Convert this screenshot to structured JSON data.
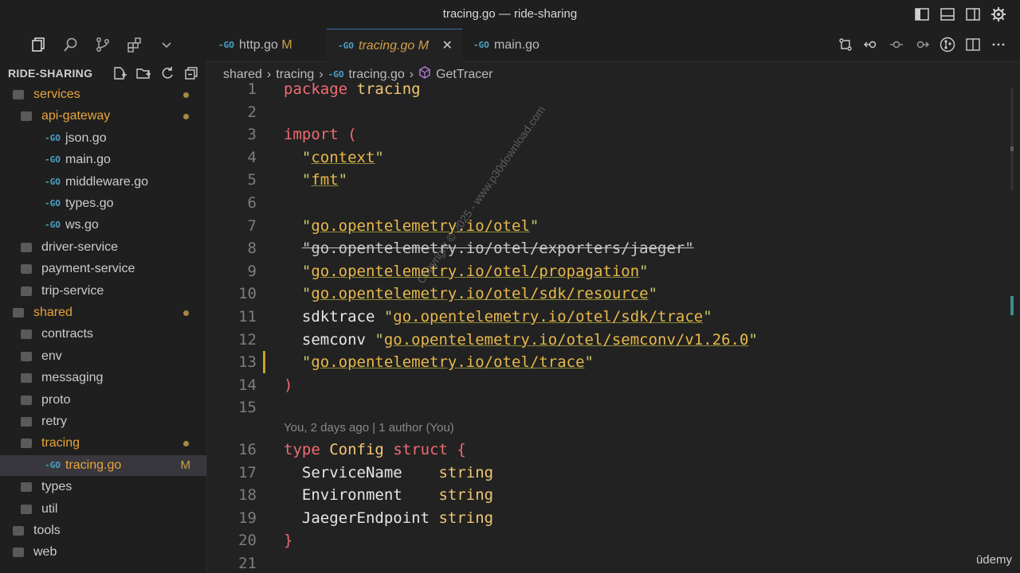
{
  "window": {
    "title": "tracing.go — ride-sharing"
  },
  "sidebar": {
    "header": "RIDE-SHARING",
    "items": [
      {
        "label": "services",
        "kind": "folder",
        "depth": 0,
        "dot": true,
        "color": "#e8a53c"
      },
      {
        "label": "api-gateway",
        "kind": "folder",
        "depth": 1,
        "dot": true,
        "color": "#e8a53c"
      },
      {
        "label": "json.go",
        "kind": "go",
        "depth": 2
      },
      {
        "label": "main.go",
        "kind": "go",
        "depth": 2
      },
      {
        "label": "middleware.go",
        "kind": "go",
        "depth": 2
      },
      {
        "label": "types.go",
        "kind": "go",
        "depth": 2
      },
      {
        "label": "ws.go",
        "kind": "go",
        "depth": 2
      },
      {
        "label": "driver-service",
        "kind": "folder",
        "depth": 1
      },
      {
        "label": "payment-service",
        "kind": "folder",
        "depth": 1
      },
      {
        "label": "trip-service",
        "kind": "folder",
        "depth": 1
      },
      {
        "label": "shared",
        "kind": "folder",
        "depth": 0,
        "dot": true,
        "color": "#e8a53c"
      },
      {
        "label": "contracts",
        "kind": "folder",
        "depth": 1
      },
      {
        "label": "env",
        "kind": "folder",
        "depth": 1
      },
      {
        "label": "messaging",
        "kind": "folder",
        "depth": 1
      },
      {
        "label": "proto",
        "kind": "folder",
        "depth": 1
      },
      {
        "label": "retry",
        "kind": "folder",
        "depth": 1
      },
      {
        "label": "tracing",
        "kind": "folder",
        "depth": 1,
        "dot": true,
        "color": "#e8a53c"
      },
      {
        "label": "tracing.go",
        "kind": "go",
        "depth": 2,
        "active": true,
        "mod": "M",
        "color": "#e8a53c"
      },
      {
        "label": "types",
        "kind": "folder",
        "depth": 1
      },
      {
        "label": "util",
        "kind": "folder",
        "depth": 1
      },
      {
        "label": "tools",
        "kind": "folder",
        "depth": 0
      },
      {
        "label": "web",
        "kind": "folder",
        "depth": 0
      }
    ]
  },
  "tabs": [
    {
      "label": "http.go",
      "mod": "M"
    },
    {
      "label": "tracing.go",
      "mod": "M",
      "active": true,
      "close": "✕"
    },
    {
      "label": "main.go",
      "mod": ""
    }
  ],
  "breadcrumb": [
    "shared",
    "tracing",
    "tracing.go",
    "GetTracer"
  ],
  "editor": {
    "codelens": "You, 2 days ago | 1 author (You)",
    "lines": [
      {
        "n": "1",
        "tokens": [
          [
            "kw",
            "package"
          ],
          [
            "id",
            " "
          ],
          [
            "ty",
            "tracing"
          ]
        ]
      },
      {
        "n": "2",
        "tokens": []
      },
      {
        "n": "3",
        "tokens": [
          [
            "kw",
            "import"
          ],
          [
            "id",
            " "
          ],
          [
            "kw",
            "("
          ]
        ]
      },
      {
        "n": "4",
        "tokens": [
          [
            "id",
            "  "
          ],
          [
            "str",
            "\""
          ],
          [
            "pth",
            "context"
          ],
          [
            "str",
            "\""
          ]
        ]
      },
      {
        "n": "5",
        "tokens": [
          [
            "id",
            "  "
          ],
          [
            "str",
            "\""
          ],
          [
            "pth",
            "fmt"
          ],
          [
            "str",
            "\""
          ]
        ]
      },
      {
        "n": "6",
        "tokens": []
      },
      {
        "n": "7",
        "tokens": [
          [
            "id",
            "  "
          ],
          [
            "str",
            "\""
          ],
          [
            "pth",
            "go.opentelemetry.io/otel"
          ],
          [
            "str",
            "\""
          ]
        ]
      },
      {
        "n": "8",
        "tokens": [
          [
            "id",
            "  "
          ],
          [
            "strike",
            "\"go.opentelemetry.io/otel/exporters/jaeger\""
          ]
        ]
      },
      {
        "n": "9",
        "tokens": [
          [
            "id",
            "  "
          ],
          [
            "str",
            "\""
          ],
          [
            "pth",
            "go.opentelemetry.io/otel/propagation"
          ],
          [
            "str",
            "\""
          ]
        ]
      },
      {
        "n": "10",
        "tokens": [
          [
            "id",
            "  "
          ],
          [
            "str",
            "\""
          ],
          [
            "pth",
            "go.opentelemetry.io/otel/sdk/resource"
          ],
          [
            "str",
            "\""
          ]
        ]
      },
      {
        "n": "11",
        "tokens": [
          [
            "id",
            "  sdktrace "
          ],
          [
            "str",
            "\""
          ],
          [
            "pth",
            "go.opentelemetry.io/otel/sdk/trace"
          ],
          [
            "str",
            "\""
          ]
        ]
      },
      {
        "n": "12",
        "tokens": [
          [
            "id",
            "  semconv "
          ],
          [
            "str",
            "\""
          ],
          [
            "pth",
            "go.opentelemetry.io/otel/semconv/v1.26.0"
          ],
          [
            "str",
            "\""
          ]
        ]
      },
      {
        "n": "13",
        "tokens": [
          [
            "id",
            "  "
          ],
          [
            "str",
            "\""
          ],
          [
            "pth",
            "go.opentelemetry.io/otel/trace"
          ],
          [
            "str",
            "\""
          ]
        ]
      },
      {
        "n": "14",
        "tokens": [
          [
            "kw",
            ")"
          ]
        ]
      },
      {
        "n": "15",
        "tokens": []
      },
      {
        "n": "16",
        "tokens": [
          [
            "kw",
            "type"
          ],
          [
            "id",
            " "
          ],
          [
            "ty",
            "Config"
          ],
          [
            "id",
            " "
          ],
          [
            "kw",
            "struct"
          ],
          [
            "id",
            " "
          ],
          [
            "kw",
            "{"
          ]
        ]
      },
      {
        "n": "17",
        "tokens": [
          [
            "id",
            "  ServiceName    "
          ],
          [
            "ty",
            "string"
          ]
        ]
      },
      {
        "n": "18",
        "tokens": [
          [
            "id",
            "  Environment    "
          ],
          [
            "ty",
            "string"
          ]
        ]
      },
      {
        "n": "19",
        "tokens": [
          [
            "id",
            "  JaegerEndpoint "
          ],
          [
            "ty",
            "string"
          ]
        ]
      },
      {
        "n": "20",
        "tokens": [
          [
            "kw",
            "}"
          ]
        ]
      },
      {
        "n": "21",
        "tokens": []
      }
    ]
  },
  "watermark": "Copyright © 2025 - www.p30download.com",
  "brand": "ūdemy"
}
